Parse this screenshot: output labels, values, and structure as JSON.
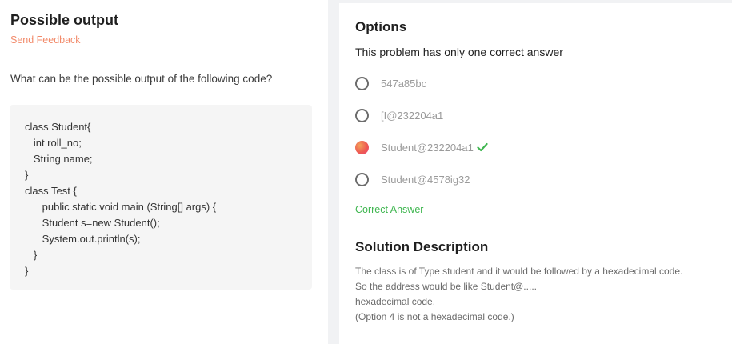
{
  "problem": {
    "title": "Possible output",
    "feedback_label": "Send Feedback",
    "question": "What can be the possible output of the following code?",
    "code": "class Student{\n   int roll_no;\n   String name;\n}\nclass Test {\n      public static void main (String[] args) {\n      Student s=new Student();\n      System.out.println(s);\n   }\n}"
  },
  "options_panel": {
    "title": "Options",
    "subtitle": "This problem has only one correct answer",
    "options": [
      {
        "label": "547a85bc",
        "selected": false
      },
      {
        "label": "[I@232204a1",
        "selected": false
      },
      {
        "label": "Student@232204a1",
        "selected": true,
        "correct": true
      },
      {
        "label": "Student@4578ig32",
        "selected": false
      }
    ],
    "correct_answer_label": "Correct Answer"
  },
  "solution": {
    "title": "Solution Description",
    "lines": [
      "The class is of Type student and it would be followed by a hexadecimal code.",
      "So the address would be like Student@.....",
      "hexadecimal code.",
      "(Option 4 is not a hexadecimal code.)"
    ]
  },
  "colors": {
    "accent_link": "#f28b6b",
    "correct_green": "#3fb650"
  },
  "icons": {
    "correct": "check-icon"
  }
}
